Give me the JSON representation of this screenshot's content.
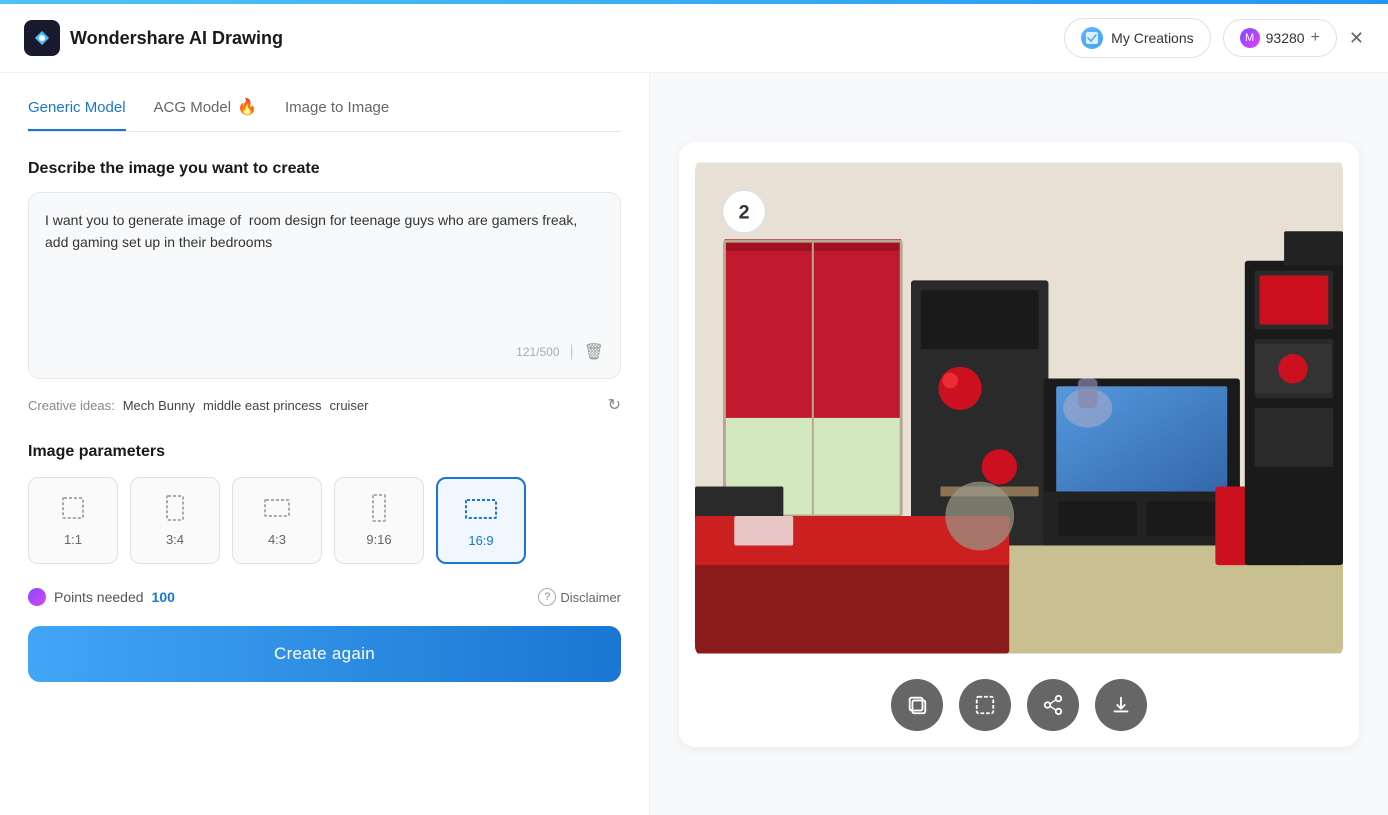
{
  "topBar": {},
  "header": {
    "appName": "Wondershare AI Drawing",
    "myCreations": "My Creations",
    "credits": "93280",
    "plusLabel": "+",
    "closeLabel": "✕"
  },
  "tabs": [
    {
      "id": "generic",
      "label": "Generic Model",
      "active": true
    },
    {
      "id": "acg",
      "label": "ACG Model",
      "fire": true
    },
    {
      "id": "image2image",
      "label": "Image to Image"
    }
  ],
  "form": {
    "describeLabel": "Describe the image you want to create",
    "promptValue": "I want you to generate image of  room design for teenage guys who are gamers freak, add gaming set up in their bedrooms",
    "promptPlaceholder": "Describe the image you want to create...",
    "charCount": "121/500",
    "creativeIdeasLabel": "Creative ideas:",
    "ideas": [
      "Mech Bunny",
      "middle east princess",
      "cruiser"
    ],
    "paramsLabel": "Image parameters",
    "aspectRatios": [
      {
        "id": "1x1",
        "label": "1:1",
        "active": false
      },
      {
        "id": "3x4",
        "label": "3:4",
        "active": false
      },
      {
        "id": "4x3",
        "label": "4:3",
        "active": false
      },
      {
        "id": "9x16",
        "label": "9:16",
        "active": false
      },
      {
        "id": "16x9",
        "label": "16:9",
        "active": true
      }
    ],
    "pointsLabel": "Points needed",
    "pointsValue": "100",
    "disclaimerLabel": "Disclaimer",
    "createAgainLabel": "Create again"
  },
  "imagePanel": {
    "badgeNumber": "2",
    "actions": [
      {
        "id": "copy",
        "icon": "⊟",
        "label": "copy-button"
      },
      {
        "id": "crop",
        "icon": "⊡",
        "label": "crop-button"
      },
      {
        "id": "share",
        "icon": "⊕",
        "label": "share-button"
      },
      {
        "id": "download",
        "icon": "↓",
        "label": "download-button"
      }
    ]
  }
}
